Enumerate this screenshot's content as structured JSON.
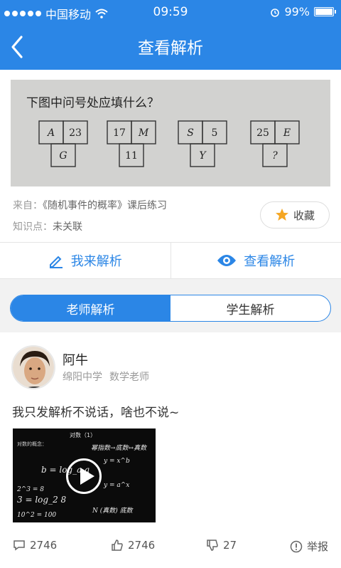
{
  "status_bar": {
    "carrier": "中国移动",
    "time": "09:59",
    "battery": "99%",
    "battery_level": 0.99
  },
  "nav": {
    "title": "查看解析",
    "back_icon": "chevron-left-icon"
  },
  "question": {
    "image_title": "下图中问号处应填什么？",
    "puzzles": [
      {
        "top_left": "A",
        "top_right": "23",
        "bottom": "G"
      },
      {
        "top_left": "17",
        "top_right": "M",
        "bottom": "11"
      },
      {
        "top_left": "S",
        "top_right": "5",
        "bottom": "Y"
      },
      {
        "top_left": "25",
        "top_right": "E",
        "bottom": "?"
      }
    ],
    "source_label": "来自：",
    "source_value": "《随机事件的概率》课后练习",
    "kp_label": "知识点：",
    "kp_value": "未关联",
    "favorite_label": "收藏"
  },
  "actions": {
    "analyze_label": "我来解析",
    "view_label": "查看解析"
  },
  "tabs": {
    "teacher": "老师解析",
    "student": "学生解析"
  },
  "answer": {
    "name": "阿牛",
    "school": "绵阳中学",
    "role": "数学老师",
    "text": "我只发解析不说话，啥也不说~",
    "video": {
      "title": "对数（1）",
      "subtitle": "对数的概念：",
      "notes": [
        "幂指数→底数↔真数",
        "y = x^b",
        "b = log_a a",
        "2^3 = 8",
        "3 = log_2 8",
        "y = a^x",
        "10^2 = 100",
        "N (真数) 底数"
      ]
    },
    "comments": "2746",
    "likes": "2746",
    "dislikes": "27",
    "report": "举报"
  },
  "colors": {
    "primary": "#2b86e6",
    "star": "#f5a623"
  }
}
